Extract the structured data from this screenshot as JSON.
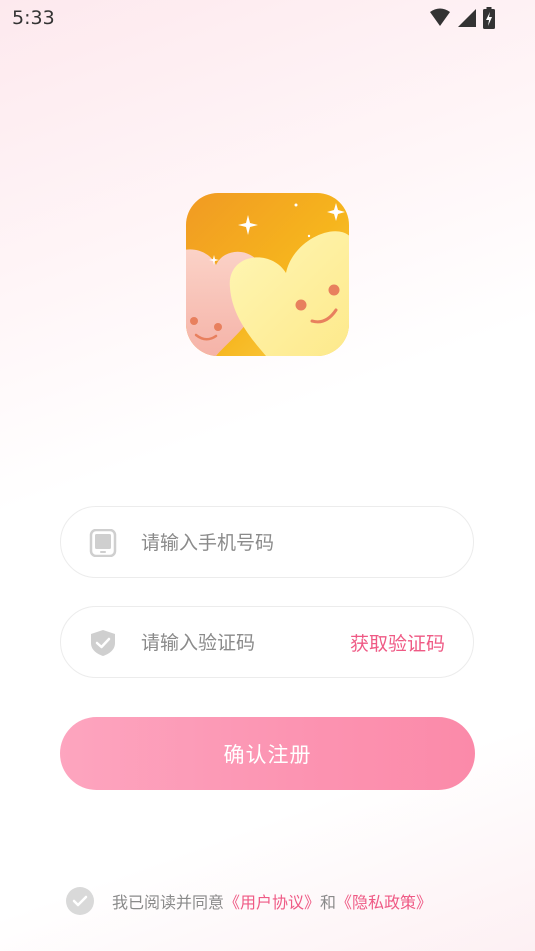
{
  "status_bar": {
    "time": "5:33",
    "icons": [
      "wifi-icon",
      "signal-icon",
      "battery-charging-icon"
    ]
  },
  "logo": {
    "icon": "app-logo-hearts-icon"
  },
  "form": {
    "phone": {
      "placeholder": "请输入手机号码",
      "icon": "tablet-icon"
    },
    "code": {
      "placeholder": "请输入验证码",
      "icon": "shield-check-icon",
      "action_label": "获取验证码"
    },
    "submit_label": "确认注册"
  },
  "agreement": {
    "prefix": "我已阅读并同意",
    "user_agreement": "《用户协议》",
    "conjunction": "和",
    "privacy_policy": "《隐私政策》",
    "checked": false
  },
  "colors": {
    "accent": "#ef5a85",
    "button_gradient_start": "#fda5bf",
    "button_gradient_end": "#fb8aa9",
    "placeholder": "#8a8a8a"
  }
}
